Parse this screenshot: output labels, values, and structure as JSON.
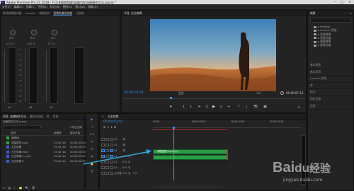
{
  "window": {
    "app_logo": "Pr",
    "title": "Adobe Premiere Pro CC 2018 - F:\\2-8视频剪辑\\加速片段\\加速制作方法.prproj *",
    "min": "—",
    "max": "□",
    "close": "✕"
  },
  "menu": [
    "文件(F)",
    "编辑(E)",
    "剪辑(C)",
    "序列(S)",
    "标记(M)",
    "图形(G)",
    "窗口(W)",
    "帮助(H)"
  ],
  "audio_mixer": {
    "tabs": [
      "音频剪辑混合器",
      "Lumetri",
      "效果控件",
      "音频轨道混合器",
      "元数据"
    ],
    "labels": [
      "A1",
      "A2",
      "A3"
    ],
    "readouts": [
      "0.0",
      "0.0",
      "0.0"
    ],
    "scale": [
      "0",
      "-6",
      "-12",
      "-18",
      "-24",
      "-30",
      "-36",
      "-42",
      "-48",
      "-54",
      "dB"
    ],
    "footer": [
      "音频 1",
      "音频 2",
      "音频 3"
    ]
  },
  "program": {
    "tab": "节目: 左右剪辑",
    "timecode_left": "00:00:02:01",
    "fit": "适合",
    "zoom": "1/2",
    "timecode_right": "00:00:07:16",
    "ruler": "00:00:00:00",
    "ruler_end": "00:00:05:00",
    "controls": [
      "⏺",
      "{",
      "}",
      "⇤",
      "◁",
      "▶",
      "▷",
      "⇥",
      "⇡",
      "⇣",
      "📷",
      "▣"
    ]
  },
  "right_panel": {
    "tabs": [
      "效果",
      "≡"
    ],
    "search_placeholder": "",
    "tree": [
      "▸ Presets",
      "▸ Lumetri 预设",
      "▸ 音频效果",
      "▸ 音频过渡",
      "▸ 视频效果",
      "▸ 视频过渡"
    ],
    "sections": [
      "基本图形",
      "基本声音",
      "Lumetri 颜色",
      "库",
      "标记",
      "历史记录",
      "信息"
    ]
  },
  "project": {
    "tabs": [
      "项目: 加速制作方法",
      "媒体浏览器",
      "库",
      "信息"
    ],
    "path": "加速制作方法.prproj",
    "item_count": "5 项已选择",
    "col_name": "名称",
    "col_framerate": "帧速率",
    "col_media": "媒体开始",
    "items": [
      {
        "name": "序列01",
        "color": "#3aa049",
        "fps": "",
        "start": ""
      },
      {
        "name": "调整图层.mp4",
        "color": "#3aa049",
        "fps": "25.00 fps",
        "start": "00:00:00:00"
      },
      {
        "name": "左右剪辑",
        "color": "#3d5ec9",
        "fps": "25.00 fps",
        "start": "00:00:00:00"
      },
      {
        "name": "左右剪辑.mp4",
        "color": "#3d5ec9",
        "fps": "25.00 fps",
        "start": "00:00:00:00"
      },
      {
        "name": "左右剪辑-1.mp4",
        "color": "#3d5ec9",
        "fps": "25.00 fps",
        "start": "00:00:00:00"
      },
      {
        "name": "左右剪辑-2",
        "color": "#3d5ec9",
        "fps": "25.00 fps",
        "start": "00:00:00:00"
      }
    ],
    "footer_icons": [
      "≡",
      "▦",
      "○",
      "⬜",
      "📁",
      "🔍",
      "🗑"
    ]
  },
  "tools": [
    "▶",
    "⇢",
    "⟷",
    "◆",
    "✂",
    "↔",
    "✎",
    "✋",
    "T"
  ],
  "timeline": {
    "tab": "左右剪辑",
    "timecode": "00:00:02:01",
    "ruler": [
      "00:00",
      "00:00:05:00",
      "00:00:10:00",
      "00:00:15:00"
    ],
    "tracks": [
      "V3",
      "V2",
      "V1",
      "A1",
      "A2",
      "A3",
      "主声道"
    ],
    "master_value": "0.0",
    "clip_v1": "调整图层.mp4 [V]",
    "clip_a1": "",
    "scale": [
      "0",
      "-6",
      "-12",
      "-18",
      "-24",
      "-30",
      "-36",
      "-42",
      "-48",
      "-54",
      "dB"
    ]
  },
  "watermark": {
    "text": "Bai",
    "paw": "du",
    "tail": "经验",
    "url": "jingyan.baidu.com"
  },
  "colors": {
    "accent": "#3d8ee8",
    "clip": "#2d9a47",
    "playhead": "#4a8fe8",
    "arrow": "#2fa7d6"
  }
}
